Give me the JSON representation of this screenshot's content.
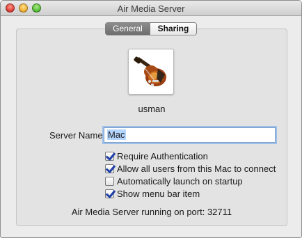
{
  "window": {
    "title": "Air Media Server"
  },
  "tabs": [
    {
      "label": "General",
      "active": true
    },
    {
      "label": "Sharing",
      "active": false
    }
  ],
  "user": {
    "name": "usman",
    "avatar_icon": "guitar-icon"
  },
  "server_name": {
    "label": "Server Name:",
    "value": "Mac"
  },
  "options": [
    {
      "label": "Require Authentication",
      "checked": true
    },
    {
      "label": "Allow all users from this Mac to connect",
      "checked": true
    },
    {
      "label": "Automatically launch on startup",
      "checked": false
    },
    {
      "label": "Show menu bar item",
      "checked": true
    }
  ],
  "status": {
    "text": "Air Media Server running on port: 32711"
  }
}
